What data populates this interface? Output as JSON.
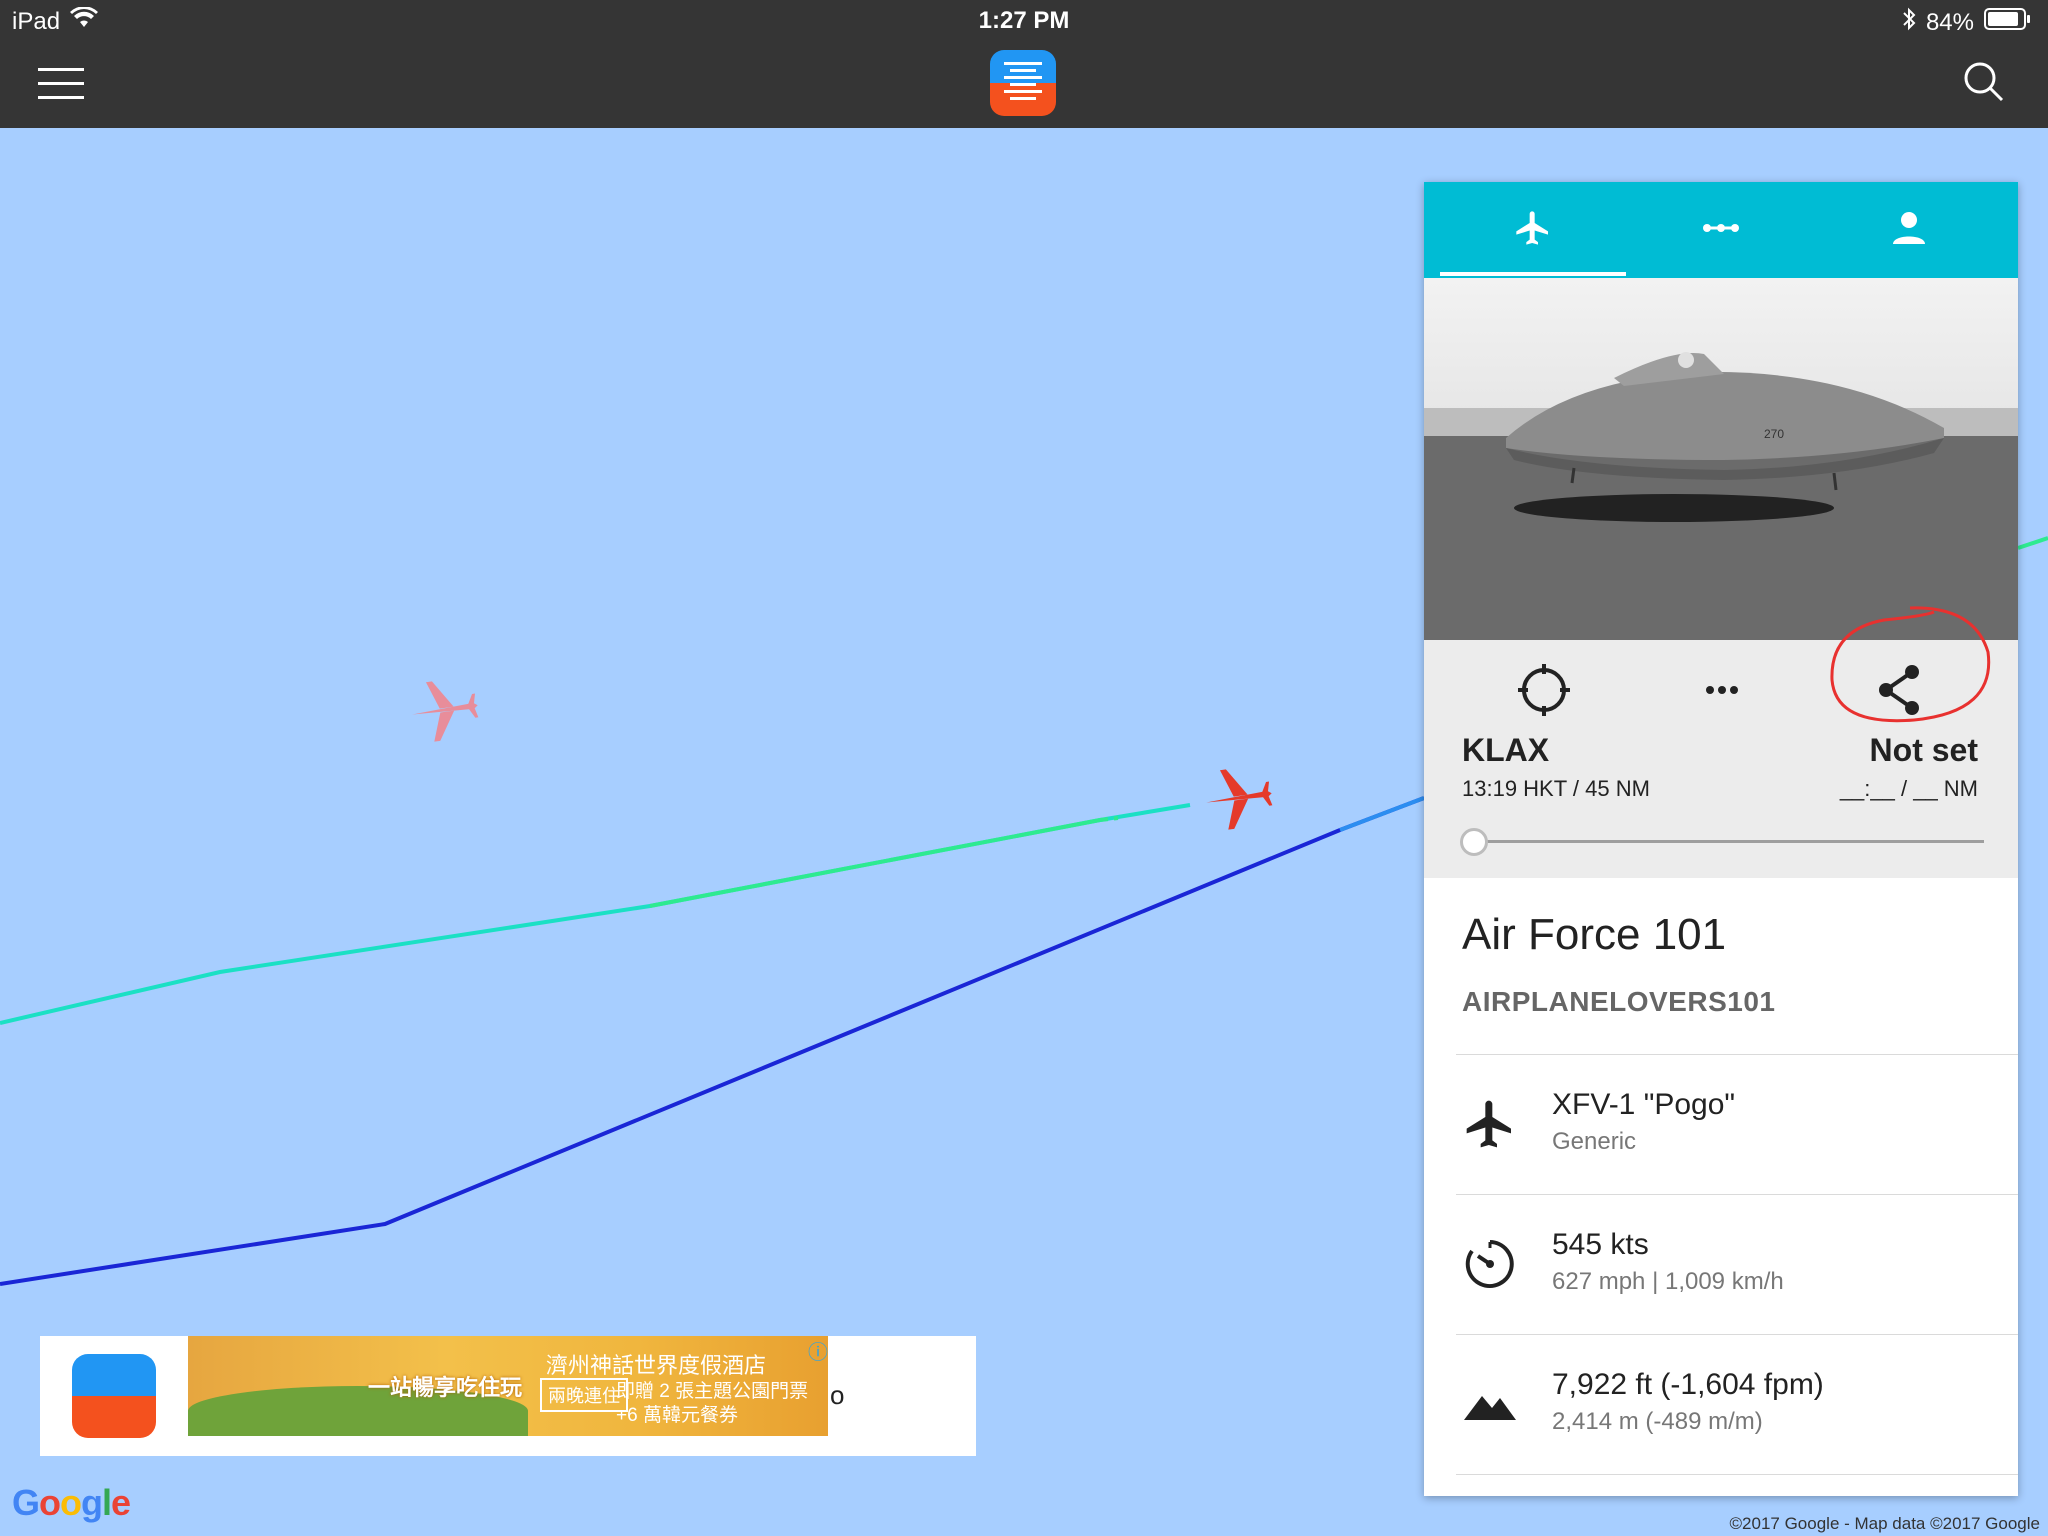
{
  "status_bar": {
    "device": "iPad",
    "time": "1:27 PM",
    "battery": "84%"
  },
  "app_bar": {
    "menu_icon": "hamburger-menu-icon",
    "logo": "flight-radar-app-logo",
    "search_icon": "search-icon"
  },
  "panel": {
    "tabs": [
      {
        "icon": "airplane-icon"
      },
      {
        "icon": "route-dots-icon"
      },
      {
        "icon": "person-icon"
      }
    ],
    "photo_caption": "270",
    "route": {
      "from_code": "KLAX",
      "from_detail": "13:19 HKT / 45 NM",
      "to_code": "Not set",
      "to_detail": "__:__ / __ NM",
      "progress": 0
    },
    "name": "Air Force 101",
    "owner": "AIRPLANELOVERS101",
    "info": [
      {
        "icon": "airplane-icon",
        "main": "XFV-1 \"Pogo\"",
        "sub": "Generic"
      },
      {
        "icon": "speed-gauge-icon",
        "main": "545 kts",
        "sub": "627 mph | 1,009 km/h"
      },
      {
        "icon": "mountain-altitude-icon",
        "main": "7,922 ft (-1,604 fpm)",
        "sub": "2,414 m (-489 m/m)"
      }
    ]
  },
  "ad": {
    "text1": "一站暢享吃住玩",
    "text2": "濟州神話世界度假酒店",
    "box": "兩晚連住",
    "text3": "即贈 2 張主題公園門票",
    "text4": "+6 萬韓元餐券",
    "tail": "o"
  },
  "map": {
    "google_logo": "Google",
    "attribution": "©2017 Google - Map data ©2017 Google"
  }
}
